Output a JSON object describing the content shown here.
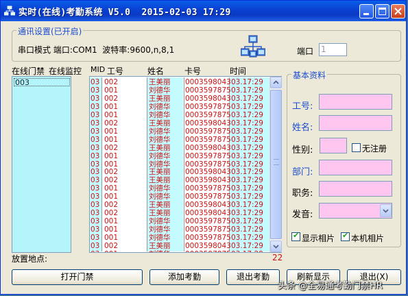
{
  "window": {
    "title": "实时(在线)考勤系统 V5.0  2015-02-03 17:29"
  },
  "comm": {
    "group_title": "通讯设置(已开启)",
    "mode_text": "串口模式 端口:COM1  波特率:9600,n,8,1",
    "port_label": "端口",
    "port_value": "1"
  },
  "left_headers": {
    "gate": "在线门禁",
    "monitor": "在线监控"
  },
  "gate_list": [
    "003"
  ],
  "record_headers": {
    "mid": "MID",
    "no": "工号",
    "name": "姓名",
    "card": "卡号",
    "time": "时间"
  },
  "records": [
    {
      "mid": "03",
      "no": "002",
      "name": "王美丽",
      "card": "0003598043",
      "time": "03.17:29"
    },
    {
      "mid": "03",
      "no": "001",
      "name": "刘德华",
      "card": "0003597875",
      "time": "03.17:29"
    },
    {
      "mid": "03",
      "no": "002",
      "name": "王美丽",
      "card": "0003598043",
      "time": "03.17:29"
    },
    {
      "mid": "03",
      "no": "001",
      "name": "刘德华",
      "card": "0003597875",
      "time": "03.17:29"
    },
    {
      "mid": "03",
      "no": "001",
      "name": "刘德华",
      "card": "0003597875",
      "time": "03.17:29"
    },
    {
      "mid": "03",
      "no": "002",
      "name": "王美丽",
      "card": "0003598043",
      "time": "03.17:29"
    },
    {
      "mid": "03",
      "no": "001",
      "name": "刘德华",
      "card": "0003597875",
      "time": "03.17:29"
    },
    {
      "mid": "03",
      "no": "001",
      "name": "刘德华",
      "card": "0003597875",
      "time": "03.17:29"
    },
    {
      "mid": "03",
      "no": "002",
      "name": "王美丽",
      "card": "0003598043",
      "time": "03.17:29"
    },
    {
      "mid": "03",
      "no": "001",
      "name": "刘德华",
      "card": "0003597875",
      "time": "03.17:29"
    },
    {
      "mid": "03",
      "no": "001",
      "name": "刘德华",
      "card": "0003597875",
      "time": "03.17:29"
    },
    {
      "mid": "03",
      "no": "002",
      "name": "王美丽",
      "card": "0003598043",
      "time": "03.17:29"
    },
    {
      "mid": "03",
      "no": "002",
      "name": "王美丽",
      "card": "0003598043",
      "time": "03.17:29"
    },
    {
      "mid": "03",
      "no": "001",
      "name": "刘德华",
      "card": "0003597875",
      "time": "03.17:29"
    },
    {
      "mid": "03",
      "no": "001",
      "name": "刘德华",
      "card": "0003597875",
      "time": "03.17:29"
    },
    {
      "mid": "03",
      "no": "002",
      "name": "王美丽",
      "card": "0003598043",
      "time": "03.17:29"
    },
    {
      "mid": "03",
      "no": "002",
      "name": "王美丽",
      "card": "0003598043",
      "time": "03.17:29"
    },
    {
      "mid": "03",
      "no": "001",
      "name": "刘德华",
      "card": "0003597875",
      "time": "03.17:29"
    },
    {
      "mid": "03",
      "no": "001",
      "name": "刘德华",
      "card": "0003597875",
      "time": "03.17:29"
    },
    {
      "mid": "03",
      "no": "001",
      "name": "刘德华",
      "card": "0003597875",
      "time": "03.17:29"
    },
    {
      "mid": "03",
      "no": "002",
      "name": "王美丽",
      "card": "0003598043",
      "time": "03.17:29"
    },
    {
      "mid": "03",
      "no": "001",
      "name": "刘德华",
      "card": "0003597875",
      "time": "03.17:29"
    }
  ],
  "location_label": "放置地点:",
  "record_count": "22",
  "basic": {
    "group_title": "基本资料",
    "id_label": "工号:",
    "name_label": "姓名:",
    "gender_label": "性别:",
    "unregistered_label": "无注册",
    "dept_label": "部门:",
    "position_label": "职务:",
    "voice_label": "发音:",
    "show_photo_label": "显示相片",
    "local_photo_label": "本机相片"
  },
  "buttons": {
    "open_gate": "打开门禁",
    "add_attendance": "添加考勤",
    "exit_attendance": "退出考勤",
    "refresh": "刷新显示",
    "exit": "退出(X)"
  },
  "watermark": "头条 @全易通考勤门禁HR",
  "colors": {
    "title_bar": "#0b3ac4",
    "record_text": "#cc1010",
    "list_cyan": "#b4f4fb",
    "field_pink": "#ffc6f0",
    "group_title": "#1b4bd0"
  },
  "icons": {
    "app": "network-icon",
    "comm": "network-computers-icon"
  }
}
